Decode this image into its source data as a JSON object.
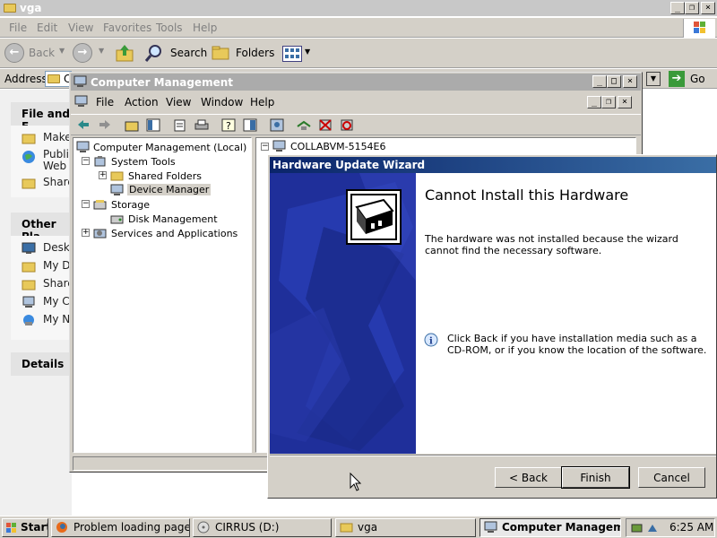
{
  "explorer": {
    "title": "vga",
    "menu": [
      "File",
      "Edit",
      "View",
      "Favorites",
      "Tools",
      "Help"
    ],
    "toolbar": {
      "back": "Back",
      "search": "Search",
      "folders": "Folders"
    },
    "address_label": "Address",
    "address_value": "C",
    "go_label": "Go",
    "task_panes": [
      {
        "title": "File and F",
        "items": [
          "Make",
          "Publis Web",
          "Share"
        ]
      },
      {
        "title": "Other Pla",
        "items": [
          "Deskt",
          "My Do",
          "Share",
          "My Co",
          "My Ne"
        ]
      },
      {
        "title": "Details",
        "items": []
      }
    ]
  },
  "cm": {
    "title": "Computer Management",
    "menu": [
      "File",
      "Action",
      "View",
      "Window",
      "Help"
    ],
    "tree": {
      "root": "Computer Management (Local)",
      "system_tools": "System Tools",
      "shared_folders": "Shared Folders",
      "device_manager": "Device Manager",
      "storage": "Storage",
      "disk_management": "Disk Management",
      "services": "Services and Applications"
    },
    "right_root": "COLLABVM-5154E6"
  },
  "wizard": {
    "title": "Hardware Update Wizard",
    "heading": "Cannot Install this Hardware",
    "message": "The hardware was not installed because the wizard cannot find the necessary software.",
    "info": "Click Back if you have installation media such as a CD-ROM, or if you know the location of the software.",
    "buttons": {
      "back": "< Back",
      "finish": "Finish",
      "cancel": "Cancel"
    }
  },
  "taskbar": {
    "start": "Start",
    "tasks": [
      "Problem loading page - ...",
      "CIRRUS (D:)",
      "vga",
      "Computer Management"
    ],
    "clock": "6:25 AM"
  },
  "colors": {
    "wizard_title": "#0a246a",
    "wizard_side": "#1f2f9a",
    "inactive_title": "#ababab"
  }
}
